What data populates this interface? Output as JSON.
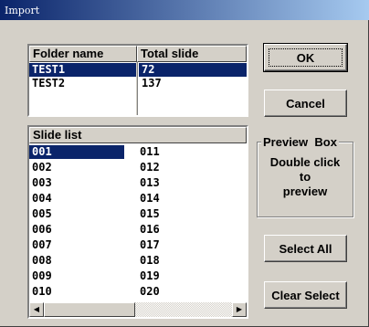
{
  "window": {
    "title": "Import"
  },
  "folders": {
    "headers": [
      "Folder name",
      "Total slide"
    ],
    "rows": [
      {
        "name": "TEST1",
        "total": "72",
        "selected": true
      },
      {
        "name": "TEST2",
        "total": "137",
        "selected": false
      }
    ]
  },
  "slides": {
    "header": "Slide list",
    "col1": [
      "001",
      "002",
      "003",
      "004",
      "005",
      "006",
      "007",
      "008",
      "009",
      "010"
    ],
    "col2": [
      "011",
      "012",
      "013",
      "014",
      "015",
      "016",
      "017",
      "018",
      "019",
      "020"
    ],
    "selected_index": 0
  },
  "buttons": {
    "ok": "OK",
    "cancel": "Cancel",
    "select_all": "Select All",
    "clear_select": "Clear Select"
  },
  "preview": {
    "label": "Preview  Box",
    "line1": "Double click",
    "line2": "to",
    "line3": "preview"
  },
  "scrollbar": {
    "left_icon": "scroll-left-arrow-icon",
    "right_icon": "scroll-right-arrow-icon"
  },
  "colors": {
    "selection": "#0a246a",
    "face": "#d4d0c8",
    "title_start": "#0a246a",
    "title_end": "#a6caf0"
  }
}
